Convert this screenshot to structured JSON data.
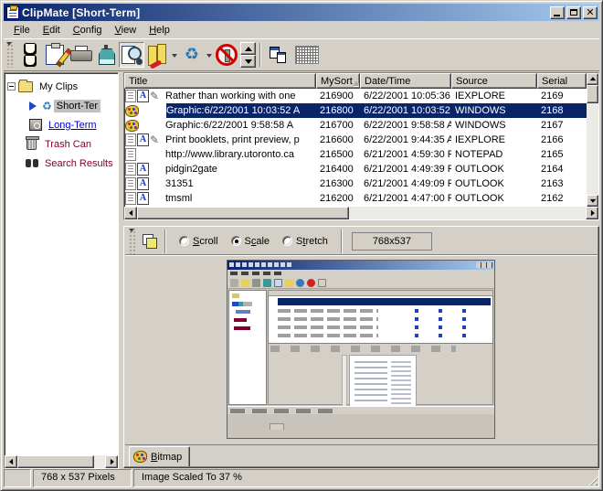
{
  "window": {
    "title": "ClipMate [Short-Term]"
  },
  "menu": {
    "items": [
      "File",
      "Edit",
      "Config",
      "View",
      "Help"
    ]
  },
  "toolbar": {
    "icons": [
      "power-outlets",
      "edit-clipboard",
      "printer",
      "glue-pot",
      "preview-magnifier",
      "exchange-clipboards",
      "recycle",
      "no-paste",
      "spin-up",
      "spin-down",
      "window-layout",
      "grid-view"
    ]
  },
  "sidebar": {
    "items": [
      {
        "label": "My Clips",
        "icon": "folder-icon",
        "selected": false
      },
      {
        "label": "Short-Ter",
        "icon": "arrow-recycle-icon",
        "selected": true
      },
      {
        "label": "Long-Term",
        "icon": "safe-icon",
        "selected": false
      },
      {
        "label": "Trash Can",
        "icon": "trash-icon",
        "selected": false
      },
      {
        "label": "Search Results",
        "icon": "binoculars-icon",
        "selected": false
      }
    ]
  },
  "list": {
    "columns": [
      "Title",
      "MySort",
      "Date/Time",
      "Source",
      "Serial"
    ],
    "sort": {
      "column": "MySort",
      "direction": "asc"
    },
    "rows": [
      {
        "title": "Rather than working with one",
        "mysort": "216900",
        "datetime": "6/22/2001 10:05:36",
        "source": "IEXPLORE",
        "serial": "2169",
        "formats": [
          "text",
          "rtf",
          "html"
        ],
        "selected": false
      },
      {
        "title": "Graphic:6/22/2001 10:03:52 A",
        "mysort": "216800",
        "datetime": "6/22/2001 10:03:52",
        "source": "WINDOWS",
        "serial": "2168",
        "formats": [
          "bitmap"
        ],
        "selected": true
      },
      {
        "title": "Graphic:6/22/2001 9:58:58 A",
        "mysort": "216700",
        "datetime": "6/22/2001 9:58:58 A",
        "source": "WINDOWS",
        "serial": "2167",
        "formats": [
          "bitmap"
        ],
        "selected": false
      },
      {
        "title": "Print booklets, print preview, p",
        "mysort": "216600",
        "datetime": "6/22/2001 9:44:35 A",
        "source": "IEXPLORE",
        "serial": "2166",
        "formats": [
          "text",
          "rtf",
          "html"
        ],
        "selected": false
      },
      {
        "title": "http://www.library.utoronto.ca",
        "mysort": "216500",
        "datetime": "6/21/2001 4:59:30 P",
        "source": "NOTEPAD",
        "serial": "2165",
        "formats": [
          "text"
        ],
        "selected": false
      },
      {
        "title": "pidgin2gate",
        "mysort": "216400",
        "datetime": "6/21/2001 4:49:39 P",
        "source": "OUTLOOK",
        "serial": "2164",
        "formats": [
          "text",
          "rtf"
        ],
        "selected": false
      },
      {
        "title": "31351",
        "mysort": "216300",
        "datetime": "6/21/2001 4:49:09 P",
        "source": "OUTLOOK",
        "serial": "2163",
        "formats": [
          "text",
          "rtf"
        ],
        "selected": false
      },
      {
        "title": "tmsml",
        "mysort": "216200",
        "datetime": "6/21/2001 4:47:00 P",
        "source": "OUTLOOK",
        "serial": "2162",
        "formats": [
          "text",
          "rtf"
        ],
        "selected": false
      }
    ]
  },
  "preview": {
    "radios": [
      {
        "pre": "",
        "accel": "S",
        "post": "croll",
        "selected": false
      },
      {
        "pre": "S",
        "accel": "c",
        "post": "ale",
        "selected": true
      },
      {
        "pre": "S",
        "accel": "t",
        "post": "retch",
        "selected": false
      }
    ],
    "size_label": "768x537",
    "tab_label": "Bitmap"
  },
  "statusbar": {
    "cells": [
      "",
      "768 x 537 Pixels",
      "Image Scaled To 37 %"
    ]
  },
  "colors": {
    "chrome": "#d4d0c8",
    "titlebar_start": "#0a246a",
    "titlebar_end": "#a6caf0",
    "selection": "#0a246a",
    "link_blue": "#0000c8",
    "special_folder_red": "#84002c"
  }
}
